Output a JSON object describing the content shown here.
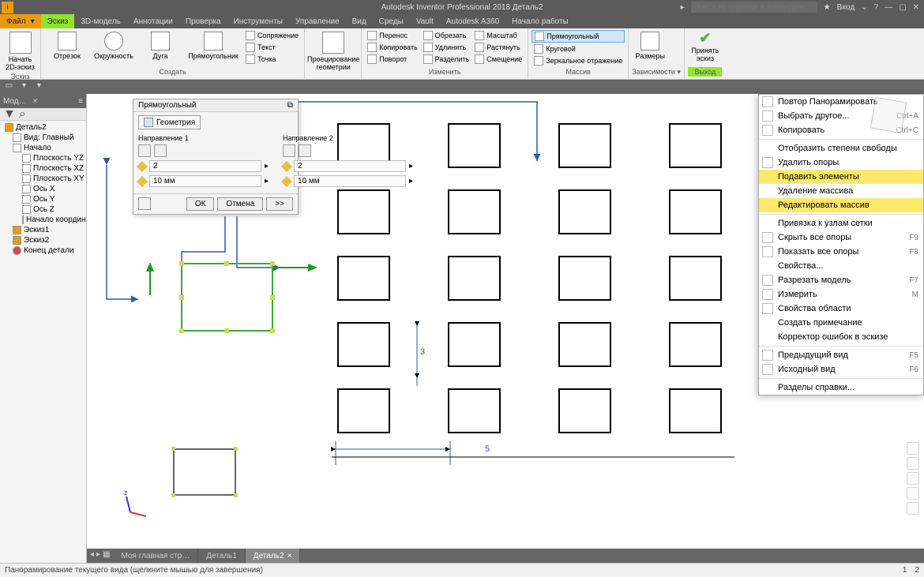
{
  "app": {
    "title": "Autodesk Inventor Professional 2018   Деталь2",
    "search_placeholder": "Поиск по справке и командам..",
    "login": "Вход"
  },
  "menu": {
    "file": "Файл",
    "items": [
      "Эскиз",
      "3D-модель",
      "Аннотации",
      "Проверка",
      "Инструменты",
      "Управление",
      "Вид",
      "Среды",
      "Vault",
      "Autodesk A360",
      "Начало работы"
    ]
  },
  "ribbon": {
    "g1": {
      "btn": "Начать\n2D-эскиз",
      "label": "Эскиз"
    },
    "g2": {
      "line": "Отрезок",
      "circle": "Окружность",
      "arc": "Дуга",
      "rect": "Прямоугольник",
      "pair": "Сопряжение",
      "text": "Текст",
      "point": "Точка",
      "label": "Создать"
    },
    "g3": {
      "btn": "Проецирование\nгеометрии"
    },
    "g4": {
      "move": "Перенос",
      "copy": "Копировать",
      "rotate": "Поворот",
      "trim": "Обрезать",
      "extend": "Удлинить",
      "split": "Разделить",
      "scale": "Масштаб",
      "stretch": "Растянуть",
      "offset": "Смещение",
      "label": "Изменить"
    },
    "g5": {
      "rect": "Прямоугольный",
      "circ": "Круговой",
      "mirror": "Зеркальное отражение",
      "label": "Массив"
    },
    "g6": {
      "dim": "Размеры",
      "label": "Зависимости"
    },
    "g7": {
      "accept": "Принять\nэскиз",
      "exit": "Выход"
    }
  },
  "browser": {
    "tab": "Мод…",
    "root": "Деталь2",
    "view": "Вид: Главный",
    "origin": "Начало",
    "planes": [
      "Плоскость YZ",
      "Плоскость XZ",
      "Плоскость XY"
    ],
    "axes": [
      "Ось X",
      "Ось Y",
      "Ось Z"
    ],
    "coord": "Начало координат",
    "sketch1": "Эскиз1",
    "sketch2": "Эскиз2",
    "end": "Конец детали"
  },
  "dialog": {
    "title": "Прямоугольный",
    "geom": "Геометрия",
    "dir1": "Направление 1",
    "dir2": "Направление 2",
    "count": "2",
    "spacing": "10 мм",
    "ok": "ОК",
    "cancel": "Отмена",
    "expand": ">>"
  },
  "dims": {
    "spacing_x": "5",
    "spacing_y": "3"
  },
  "context": [
    {
      "label": "Повтор Панорамировать",
      "icon": true
    },
    {
      "label": "Выбрать другое...",
      "short": "Ctrl+A",
      "icon": true
    },
    {
      "label": "Копировать",
      "short": "Ctrl+C",
      "icon": true,
      "sep": true
    },
    {
      "label": "Отобразить степени свободы"
    },
    {
      "label": "Удалить опоры",
      "icon": true
    },
    {
      "label": "Подавить элементы",
      "hl": true
    },
    {
      "label": "Удаление массива"
    },
    {
      "label": "Редактировать массив",
      "hl": true,
      "sep": true
    },
    {
      "label": "Привязка к узлам сетки"
    },
    {
      "label": "Скрыть все опоры",
      "short": "F9",
      "icon": true
    },
    {
      "label": "Показать все опоры",
      "short": "F8",
      "icon": true
    },
    {
      "label": "Свойства..."
    },
    {
      "label": "Разрезать модель",
      "short": "F7",
      "icon": true
    },
    {
      "label": "Измерить",
      "short": "M",
      "icon": true
    },
    {
      "label": "Свойства области",
      "icon": true
    },
    {
      "label": "Создать примечание"
    },
    {
      "label": "Корректор ошибок в эскизе",
      "sep": true
    },
    {
      "label": "Предыдущий вид",
      "short": "F5",
      "icon": true
    },
    {
      "label": "Исходный вид",
      "short": "F6",
      "icon": true,
      "sep": true
    },
    {
      "label": "Разделы справки..."
    }
  ],
  "doctabs": {
    "home": "Моя главная стр…",
    "d1": "Деталь1",
    "d2": "Деталь2"
  },
  "status": {
    "text": "Панорамирование текущего вида (щелкните мышью для завершения)",
    "n1": "1",
    "n2": "2"
  }
}
